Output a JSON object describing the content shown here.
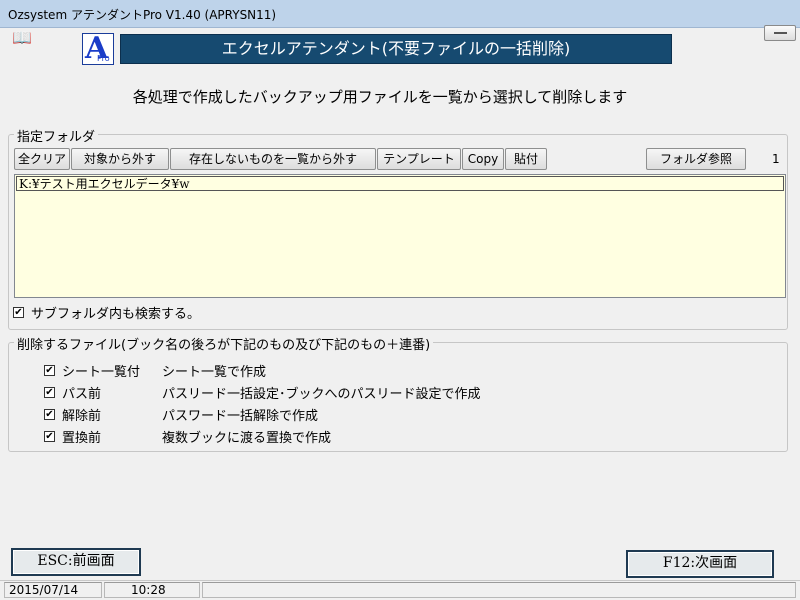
{
  "window": {
    "title": "Ozsystem アテンダントPro V1.40 (APRYSN11)"
  },
  "header": {
    "logo_letter": "A",
    "logo_sub": "Pro",
    "banner": "エクセルアテンダント(不要ファイルの一括削除)",
    "subtitle": "各処理で作成したバックアップ用ファイルを一覧から選択して削除します"
  },
  "folder_group": {
    "legend": "指定フォルダ",
    "toolbar": {
      "clear_all": "全クリア",
      "exclude": "対象から外す",
      "exclude_missing": "存在しないものを一覧から外す",
      "template": "テンプレート",
      "copy": "Copy",
      "paste": "貼付",
      "browse": "フォルダ参照"
    },
    "count": "1",
    "folders": [
      "K:¥テスト用エクセルデータ¥w"
    ],
    "subfolder_label": "サブフォルダ内も検索する。",
    "subfolder_checked": true
  },
  "delete_group": {
    "legend": "削除するファイル(ブック名の後ろが下記のもの及び下記のもの＋連番)",
    "items": [
      {
        "name": "シート一覧付",
        "desc": "シート一覧で作成",
        "checked": true
      },
      {
        "name": "パス前",
        "desc": "パスリード一括設定･ブックへのパスリード設定で作成",
        "checked": true
      },
      {
        "name": "解除前",
        "desc": "パスワード一括解除で作成",
        "checked": true
      },
      {
        "name": "置換前",
        "desc": "複数ブックに渡る置換で作成",
        "checked": true
      }
    ]
  },
  "footer": {
    "back_button": "ESC:前画面",
    "next_button": "F12:次画面"
  },
  "statusbar": {
    "date": "2015/07/14",
    "time": "10:28"
  }
}
